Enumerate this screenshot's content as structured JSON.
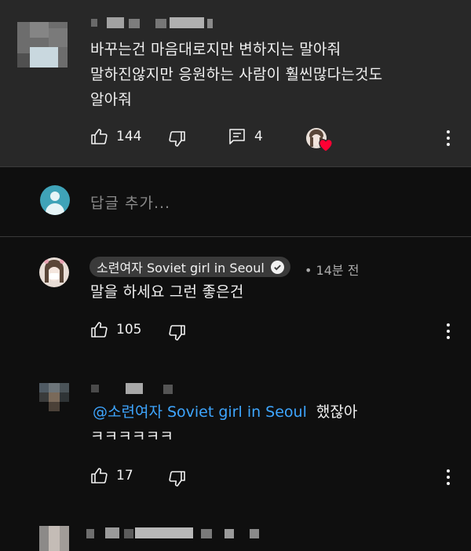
{
  "comments": [
    {
      "lines": [
        "바꾸는건 마음대로지만 변하지는 말아줘",
        "말하진않지만 응원하는 사람이 훨씬많다는것도",
        "알아줘"
      ],
      "likes": "144",
      "replies": "4"
    },
    {
      "author": "소련여자 Soviet girl in Seoul",
      "time": "• 14분 전",
      "text": "말을 하세요 그런 좋은건",
      "likes": "105"
    },
    {
      "mention": "@소련여자 Soviet girl in Seoul",
      "suffix": "했잖아",
      "line2": "ㅋㅋㅋㅋㅋㅋ",
      "likes": "17"
    }
  ],
  "reply_box": {
    "placeholder": "답글 추가..."
  },
  "colors": {
    "background": "#0f0f0f",
    "highlighted_background": "#282828",
    "link": "#3ea6ff",
    "heart": "#ff0033"
  },
  "icons": [
    "like-icon",
    "dislike-icon",
    "reply-icon",
    "more-vert-icon",
    "verified-check-icon",
    "heart-icon"
  ]
}
